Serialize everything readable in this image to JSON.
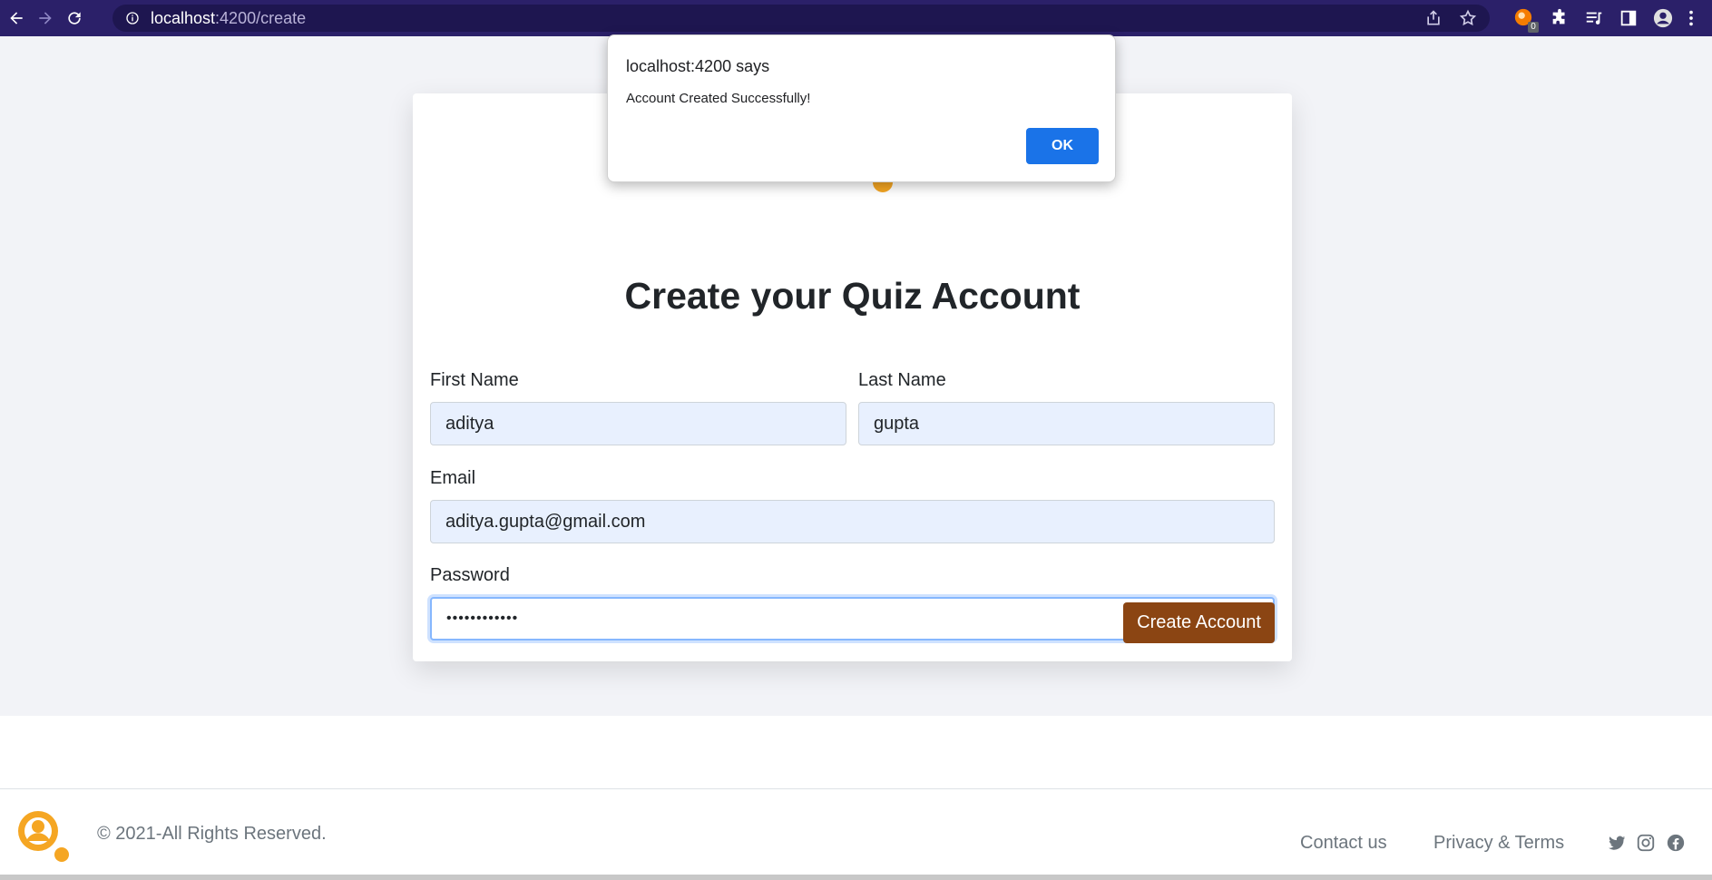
{
  "browser": {
    "url_host": "localhost",
    "url_path": ":4200/create",
    "extension_badge_count": "0"
  },
  "dialog": {
    "title": "localhost:4200 says",
    "message": "Account Created Successfully!",
    "ok_label": "OK"
  },
  "form": {
    "title": "Create your Quiz Account",
    "first_name_label": "First Name",
    "first_name_value": "aditya",
    "last_name_label": "Last Name",
    "last_name_value": "gupta",
    "email_label": "Email",
    "email_value": "aditya.gupta@gmail.com",
    "password_label": "Password",
    "password_value": "••••••••••••",
    "submit_label": "Create Account"
  },
  "footer": {
    "copyright": "© 2021-All Rights Reserved.",
    "links": [
      "Contact us",
      "Privacy & Terms"
    ],
    "social_icons": [
      "twitter-icon",
      "instagram-icon",
      "facebook-icon"
    ]
  },
  "colors": {
    "browser_frame": "#2b2069",
    "submit_button": "#8b4513",
    "dialog_ok": "#1a73e8",
    "brand_accent": "#f5a623"
  }
}
